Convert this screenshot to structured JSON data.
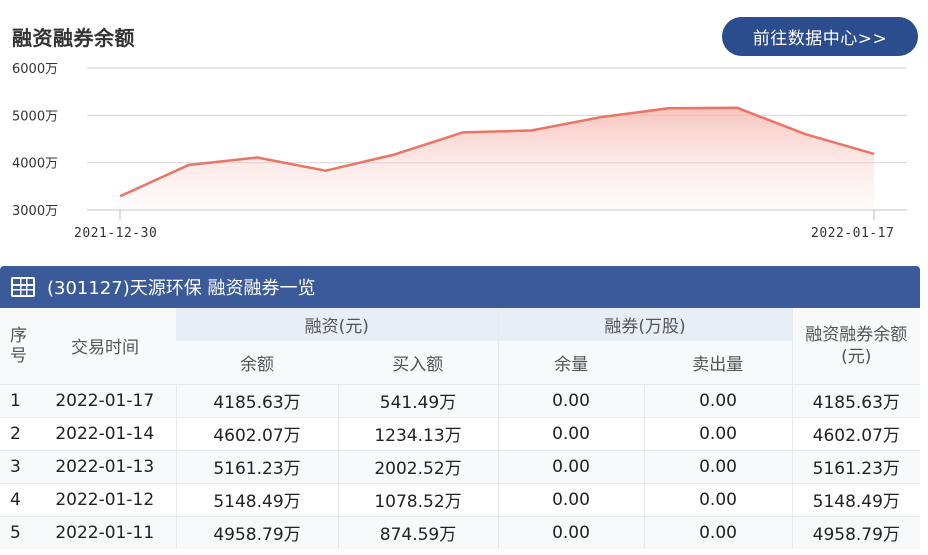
{
  "chart": {
    "title": "融资融券余额",
    "button_label": "前往数据中心>>"
  },
  "chart_data": {
    "type": "area",
    "y_tick_labels": [
      "6000万",
      "5000万",
      "4000万",
      "3000万"
    ],
    "y_ticks": [
      6000,
      5000,
      4000,
      3000
    ],
    "ylim": [
      3000,
      6000
    ],
    "x_labels": [
      "2021-12-30",
      "2022-01-17"
    ],
    "x": [
      "2021-12-30",
      "2021-12-31",
      "2022-01-04",
      "2022-01-05",
      "2022-01-06",
      "2022-01-07",
      "2022-01-10",
      "2022-01-11",
      "2022-01-12",
      "2022-01-13",
      "2022-01-14",
      "2022-01-17"
    ],
    "series": [
      {
        "values": [
          3290,
          3950,
          4110,
          3830,
          4170,
          4640,
          4680,
          4958.79,
          5148.49,
          5161.23,
          4602.07,
          4185.63
        ]
      }
    ],
    "unit": "万",
    "grid": true,
    "line_color": "#e87565",
    "fill_color": "#f9d2cc"
  },
  "table": {
    "header_title": "(301127)天源环保 融资融券一览",
    "columns": {
      "seq": "序号",
      "date": "交易时间",
      "financing_group": "融资(元)",
      "fin_balance": "余额",
      "fin_buy": "买入额",
      "lending_group": "融券(万股)",
      "lend_balance": "余量",
      "lend_sell": "卖出量",
      "total": "融资融券余额(元)"
    },
    "rows": [
      {
        "seq": "1",
        "date": "2022-01-17",
        "fin_balance": "4185.63万",
        "fin_buy": "541.49万",
        "lend_balance": "0.00",
        "lend_sell": "0.00",
        "total": "4185.63万"
      },
      {
        "seq": "2",
        "date": "2022-01-14",
        "fin_balance": "4602.07万",
        "fin_buy": "1234.13万",
        "lend_balance": "0.00",
        "lend_sell": "0.00",
        "total": "4602.07万"
      },
      {
        "seq": "3",
        "date": "2022-01-13",
        "fin_balance": "5161.23万",
        "fin_buy": "2002.52万",
        "lend_balance": "0.00",
        "lend_sell": "0.00",
        "total": "5161.23万"
      },
      {
        "seq": "4",
        "date": "2022-01-12",
        "fin_balance": "5148.49万",
        "fin_buy": "1078.52万",
        "lend_balance": "0.00",
        "lend_sell": "0.00",
        "total": "5148.49万"
      },
      {
        "seq": "5",
        "date": "2022-01-11",
        "fin_balance": "4958.79万",
        "fin_buy": "874.59万",
        "lend_balance": "0.00",
        "lend_sell": "0.00",
        "total": "4958.79万"
      }
    ]
  }
}
